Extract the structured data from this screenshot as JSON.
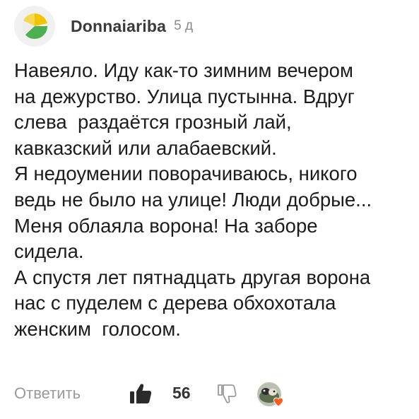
{
  "comment": {
    "author": "Donnaiariba",
    "time_ago": "5 д",
    "text_lines": [
      "Навеяло. Иду как-то зимним вечером",
      "на дежурство. Улица пустынна. Вдруг",
      "слева  раздаётся грозный лай,",
      "кавказский или алабаевский.",
      "Я недоумении поворачиваюсь, никого",
      "ведь не было на улице! Люди добрые...",
      "Меня облаяла ворона! На заборе",
      "сидела.",
      "А спустя лет пятнадцать другая ворона",
      "нас с пуделем с дерева обхохотала",
      "женским  голосом."
    ]
  },
  "actions": {
    "reply_label": "Ответить",
    "like_count": "56",
    "like_icon": "thumbs-up-icon",
    "dislike_icon": "thumbs-down-icon",
    "reaction_badge_icon": "heart-icon"
  },
  "colors": {
    "avatar_yellow": "#f2c400",
    "avatar_green": "#4caf50",
    "heart": "#ff5a1f",
    "muted_text": "#9a9a9a"
  }
}
